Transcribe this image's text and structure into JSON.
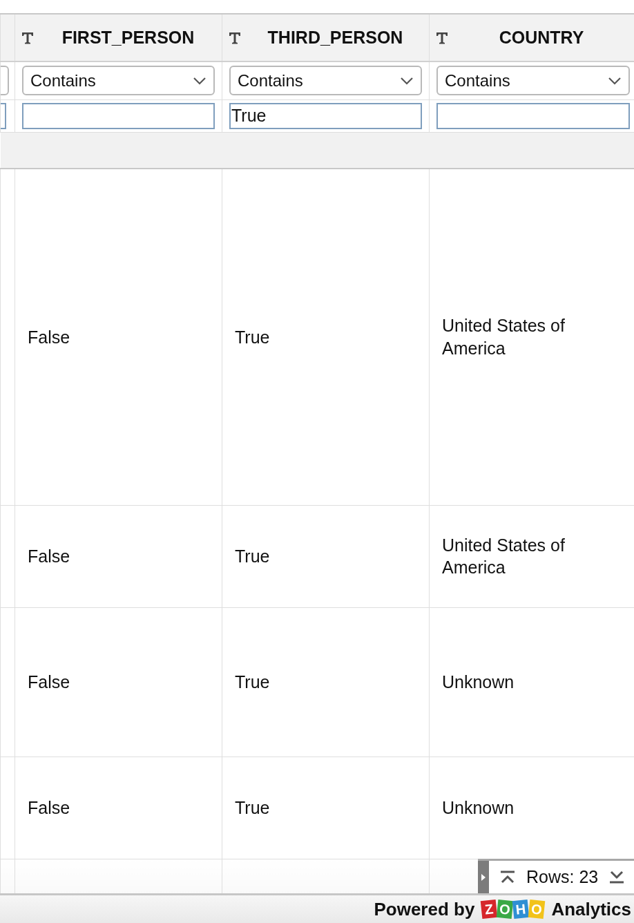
{
  "columns": [
    {
      "name": "FIRST_PERSON",
      "filter_operator": "Contains"
    },
    {
      "name": "THIRD_PERSON",
      "filter_operator": "Contains",
      "filter_value": "True"
    },
    {
      "name": "COUNTRY",
      "filter_operator": "Contains"
    }
  ],
  "rows": [
    {
      "cells": [
        "False",
        "True",
        "United States of America"
      ]
    },
    {
      "cells": [
        "False",
        "True",
        "United States of America"
      ]
    },
    {
      "cells": [
        "False",
        "True",
        "Unknown"
      ]
    },
    {
      "cells": [
        "False",
        "True",
        "Unknown"
      ]
    }
  ],
  "pager": {
    "label": "Rows: 23"
  },
  "footer": {
    "powered_by": "Powered by",
    "logo_letters": [
      {
        "letter": "Z",
        "color": "#d6262b"
      },
      {
        "letter": "O",
        "color": "#3aa845"
      },
      {
        "letter": "H",
        "color": "#2f8fd3"
      },
      {
        "letter": "O",
        "color": "#f2c31a"
      }
    ],
    "product": "Analytics"
  }
}
